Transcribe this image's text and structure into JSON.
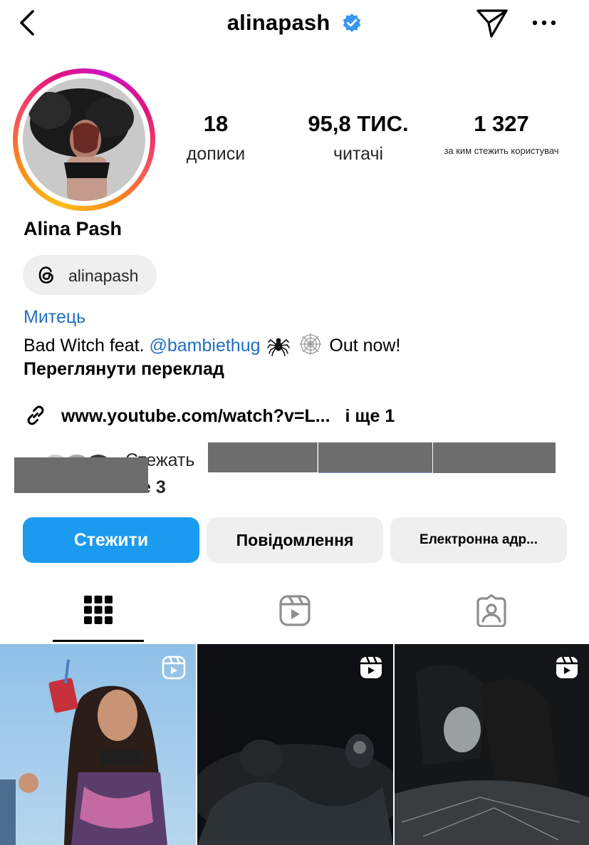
{
  "header": {
    "username": "alinapash",
    "icons": {
      "back": "chevron-left-icon",
      "verified": "verified-badge-icon",
      "send": "paper-plane-icon",
      "more": "more-dots-icon"
    },
    "verified_color": "#3897f0"
  },
  "stats": [
    {
      "value": "18",
      "label": "дописи"
    },
    {
      "value": "95,8 ТИС.",
      "label": "читачі"
    },
    {
      "value": "1 327",
      "label": "за ким стежить користувач"
    }
  ],
  "profile": {
    "full_name": "Alina Pash",
    "threads_handle": "alinapash",
    "category": "Митець",
    "bio_prefix": "Bad Witch feat.",
    "bio_mention": "@bambiethug",
    "bio_emojis": [
      "spider-emoji",
      "spider-web-emoji"
    ],
    "bio_suffix": "Out now!",
    "translate_label": "Переглянути переклад",
    "link_text": "www.youtube.com/watch?v=L...",
    "link_more": "і ще 1"
  },
  "followed_by": {
    "text": "Стежать",
    "text2": "е 3"
  },
  "buttons": {
    "follow": "Стежити",
    "message": "Повідомлення",
    "email": "Електронна адр..."
  },
  "tabs": [
    {
      "icon": "grid-icon",
      "active": true
    },
    {
      "icon": "reels-icon",
      "active": false
    },
    {
      "icon": "tagged-icon",
      "active": false
    }
  ],
  "colors": {
    "accent": "#1a9bf0",
    "link": "#1f6fc4",
    "button_secondary": "#efefef"
  }
}
